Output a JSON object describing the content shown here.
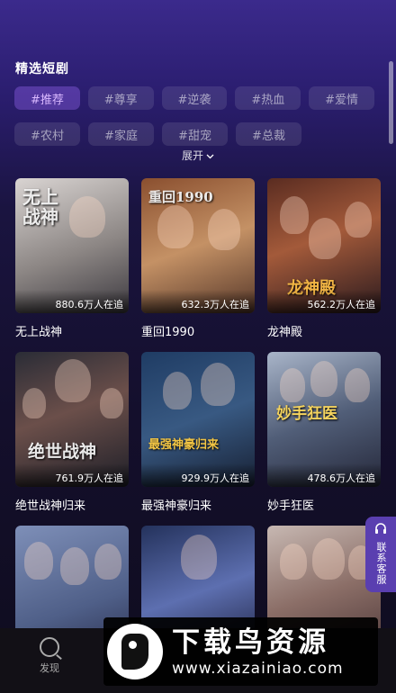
{
  "section": {
    "title": "精选短剧"
  },
  "tags": [
    [
      {
        "label": "#推荐",
        "active": true
      },
      {
        "label": "#尊享"
      },
      {
        "label": "#逆袭"
      },
      {
        "label": "#热血"
      },
      {
        "label": "#爱情"
      }
    ],
    [
      {
        "label": "#农村"
      },
      {
        "label": "#家庭"
      },
      {
        "label": "#甜宠"
      },
      {
        "label": "#总裁"
      }
    ]
  ],
  "expand": {
    "label": "展开",
    "icon": "chevron-down-icon"
  },
  "dramas": [
    {
      "title": "无上战神",
      "views": "880.6万人在追",
      "poster_text": "无上战神"
    },
    {
      "title": "重回1990",
      "views": "632.3万人在追",
      "poster_text": "重回1990"
    },
    {
      "title": "龙神殿",
      "views": "562.2万人在追",
      "poster_text": "龙神殿"
    },
    {
      "title": "绝世战神归来",
      "views": "761.9万人在追",
      "poster_text": "绝世战神"
    },
    {
      "title": "最强神豪归来",
      "views": "929.9万人在追",
      "poster_text": "最强神豪归来"
    },
    {
      "title": "妙手狂医",
      "views": "478.6万人在追",
      "poster_text": "妙手狂医"
    },
    {
      "title": "",
      "views": "",
      "poster_text": ""
    },
    {
      "title": "",
      "views": "",
      "poster_text": ""
    },
    {
      "title": "",
      "views": "",
      "poster_text": ""
    }
  ],
  "side_service": {
    "label": "联系客服",
    "icon": "headset-icon"
  },
  "bottom_nav": {
    "discover_label": "发现"
  },
  "watermark": {
    "title": "下载鸟资源",
    "url": "www.xiazainiao.com"
  }
}
